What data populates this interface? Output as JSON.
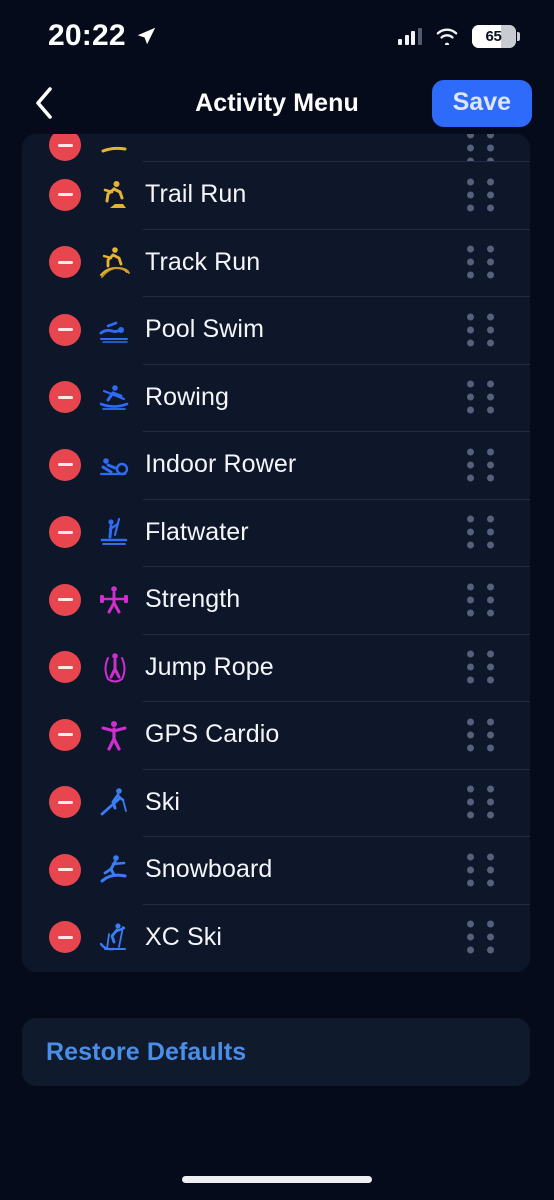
{
  "status_bar": {
    "time": "20:22",
    "location_icon": "location-arrow-icon",
    "cellular_icon": "cellular-signal-icon",
    "wifi_icon": "wifi-icon",
    "battery_level": "65"
  },
  "nav_bar": {
    "back_icon": "chevron-left-icon",
    "title": "Activity Menu",
    "save_label": "Save",
    "save_color": "#2f6bfa"
  },
  "colors": {
    "page_background": "#060b1c",
    "card_background": "#0e1629",
    "divider": "#222c42",
    "remove_button": "#e8464f",
    "drag_handle": "#55607a",
    "label_text": "#f4f6fa",
    "link_text": "#4a8ee8",
    "icon_gold": "#e8b334",
    "icon_blue": "#2f6bf5",
    "icon_magenta": "#d02ed0"
  },
  "activity_list": {
    "remove_icon": "minus-circle-icon",
    "drag_icon": "drag-handle-icon",
    "partial_row_above": {
      "icon": "run-icon",
      "icon_color": "#e8b334"
    },
    "items": [
      {
        "label": "Trail Run",
        "icon": "trail-run-icon",
        "icon_color": "#e8b334"
      },
      {
        "label": "Track Run",
        "icon": "track-run-icon",
        "icon_color": "#e8b334"
      },
      {
        "label": "Pool Swim",
        "icon": "pool-swim-icon",
        "icon_color": "#2f6bf5"
      },
      {
        "label": "Rowing",
        "icon": "rowing-icon",
        "icon_color": "#2f6bf5"
      },
      {
        "label": "Indoor Rower",
        "icon": "indoor-rower-icon",
        "icon_color": "#2f6bf5"
      },
      {
        "label": "Flatwater",
        "icon": "flatwater-icon",
        "icon_color": "#2f6bf5"
      },
      {
        "label": "Strength",
        "icon": "strength-icon",
        "icon_color": "#d02ed0"
      },
      {
        "label": "Jump Rope",
        "icon": "jump-rope-icon",
        "icon_color": "#d02ed0"
      },
      {
        "label": "GPS Cardio",
        "icon": "gps-cardio-icon",
        "icon_color": "#d02ed0"
      },
      {
        "label": "Ski",
        "icon": "ski-icon",
        "icon_color": "#3b7df5"
      },
      {
        "label": "Snowboard",
        "icon": "snowboard-icon",
        "icon_color": "#3b7df5"
      },
      {
        "label": "XC Ski",
        "icon": "xc-ski-icon",
        "icon_color": "#3b7df5"
      }
    ]
  },
  "restore": {
    "label": "Restore Defaults"
  },
  "home_indicator": "home-indicator"
}
